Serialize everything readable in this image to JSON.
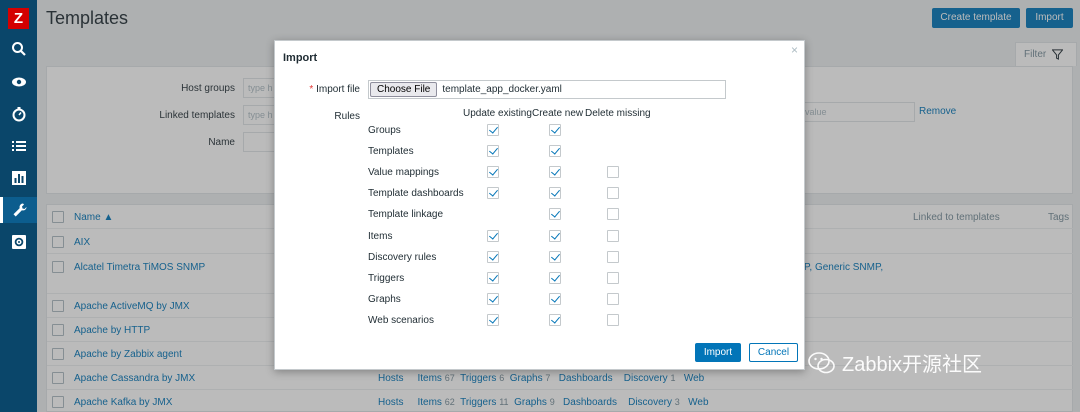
{
  "header": {
    "title": "Templates",
    "create_label": "Create template",
    "import_label": "Import"
  },
  "sidebar": {
    "logo": "Z",
    "icons": [
      "search-icon",
      "eye-icon",
      "stopwatch-icon",
      "list-icon",
      "chart-icon",
      "wrench-icon",
      "gear-icon"
    ]
  },
  "filter": {
    "tab_label": "Filter",
    "host_groups_label": "Host groups",
    "host_groups_placeholder": "type h",
    "linked_templates_label": "Linked templates",
    "linked_templates_placeholder": "type h",
    "name_label": "Name",
    "value_placeholder": "value",
    "remove_label": "Remove"
  },
  "table": {
    "col_name": "Name ▲",
    "col_linked_to": "Linked to templates",
    "col_tags": "Tags",
    "rows": [
      {
        "name": "AIX",
        "extra": ""
      },
      {
        "name": "Alcatel Timetra TiMOS SNMP",
        "extra": "P, Generic SNMP,"
      },
      {
        "name": "Apache ActiveMQ by JMX",
        "extra": ""
      },
      {
        "name": "Apache by HTTP",
        "extra": ""
      },
      {
        "name": "Apache by Zabbix agent",
        "extra": ""
      },
      {
        "name": "Apache Cassandra by JMX",
        "extra": ""
      },
      {
        "name": "Apache Kafka by JMX",
        "extra": ""
      }
    ],
    "cassandra_links": {
      "hosts": "Hosts",
      "items": "Items",
      "items_n": "67",
      "triggers": "Triggers",
      "triggers_n": "6",
      "graphs": "Graphs",
      "graphs_n": "7",
      "dashboards": "Dashboards",
      "discovery": "Discovery",
      "discovery_n": "1",
      "web": "Web"
    },
    "kafka_links": {
      "hosts": "Hosts",
      "items": "Items",
      "items_n": "62",
      "triggers": "Triggers",
      "triggers_n": "11",
      "graphs": "Graphs",
      "graphs_n": "9",
      "dashboards": "Dashboards",
      "discovery": "Discovery",
      "discovery_n": "3",
      "web": "Web"
    }
  },
  "dialog": {
    "title": "Import",
    "close": "×",
    "import_file_label": "Import file",
    "choose_file_label": "Choose File",
    "file_name": "template_app_docker.yaml",
    "rules_label": "Rules",
    "col_update": "Update existing",
    "col_create": "Create new",
    "col_delete": "Delete missing",
    "rules": [
      {
        "label": "Groups",
        "update": true,
        "create": true,
        "delete": null
      },
      {
        "label": "Templates",
        "update": true,
        "create": true,
        "delete": null
      },
      {
        "label": "Value mappings",
        "update": true,
        "create": true,
        "delete": false
      },
      {
        "label": "Template dashboards",
        "update": true,
        "create": true,
        "delete": false
      },
      {
        "label": "Template linkage",
        "update": null,
        "create": true,
        "delete": false
      },
      {
        "label": "Items",
        "update": true,
        "create": true,
        "delete": false
      },
      {
        "label": "Discovery rules",
        "update": true,
        "create": true,
        "delete": false
      },
      {
        "label": "Triggers",
        "update": true,
        "create": true,
        "delete": false
      },
      {
        "label": "Graphs",
        "update": true,
        "create": true,
        "delete": false
      },
      {
        "label": "Web scenarios",
        "update": true,
        "create": true,
        "delete": false
      }
    ],
    "import_button": "Import",
    "cancel_button": "Cancel"
  },
  "watermark": "Zabbix开源社区"
}
